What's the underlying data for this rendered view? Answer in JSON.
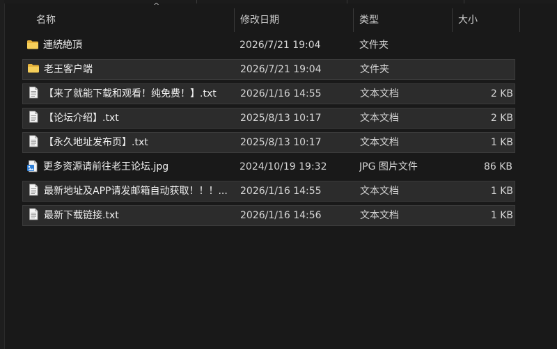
{
  "columns": {
    "name": "名称",
    "date": "修改日期",
    "type": "类型",
    "size": "大小"
  },
  "sort_indicator": "^",
  "files": [
    {
      "name": "連続絶頂",
      "date": "2026/7/21 19:04",
      "type": "文件夹",
      "size": "",
      "icon": "folder-icon",
      "selected": false
    },
    {
      "name": "老王客户端",
      "date": "2026/7/21 19:04",
      "type": "文件夹",
      "size": "",
      "icon": "folder-icon",
      "selected": true
    },
    {
      "name": "【来了就能下载和观看！纯免费！】.txt",
      "date": "2026/1/16 14:55",
      "type": "文本文档",
      "size": "2 KB",
      "icon": "text-file-icon",
      "selected": true
    },
    {
      "name": "【论坛介绍】.txt",
      "date": "2025/8/13 10:17",
      "type": "文本文档",
      "size": "2 KB",
      "icon": "text-file-icon",
      "selected": true
    },
    {
      "name": "【永久地址发布页】.txt",
      "date": "2025/8/13 10:17",
      "type": "文本文档",
      "size": "1 KB",
      "icon": "text-file-icon",
      "selected": true
    },
    {
      "name": "更多资源请前往老王论坛.jpg",
      "date": "2024/10/19 19:32",
      "type": "JPG 图片文件",
      "size": "86 KB",
      "icon": "image-file-icon",
      "selected": false
    },
    {
      "name": "最新地址及APP请发邮箱自动获取！！！...",
      "date": "2026/1/16 14:55",
      "type": "文本文档",
      "size": "1 KB",
      "icon": "text-file-icon",
      "selected": true
    },
    {
      "name": "最新下载链接.txt",
      "date": "2026/1/16 14:56",
      "type": "文本文档",
      "size": "1 KB",
      "icon": "text-file-icon",
      "selected": true
    }
  ],
  "colors": {
    "background": "#191919",
    "selection": "#2c2c2c",
    "folder": "#f2c14e",
    "text": "#f0f0f0"
  }
}
